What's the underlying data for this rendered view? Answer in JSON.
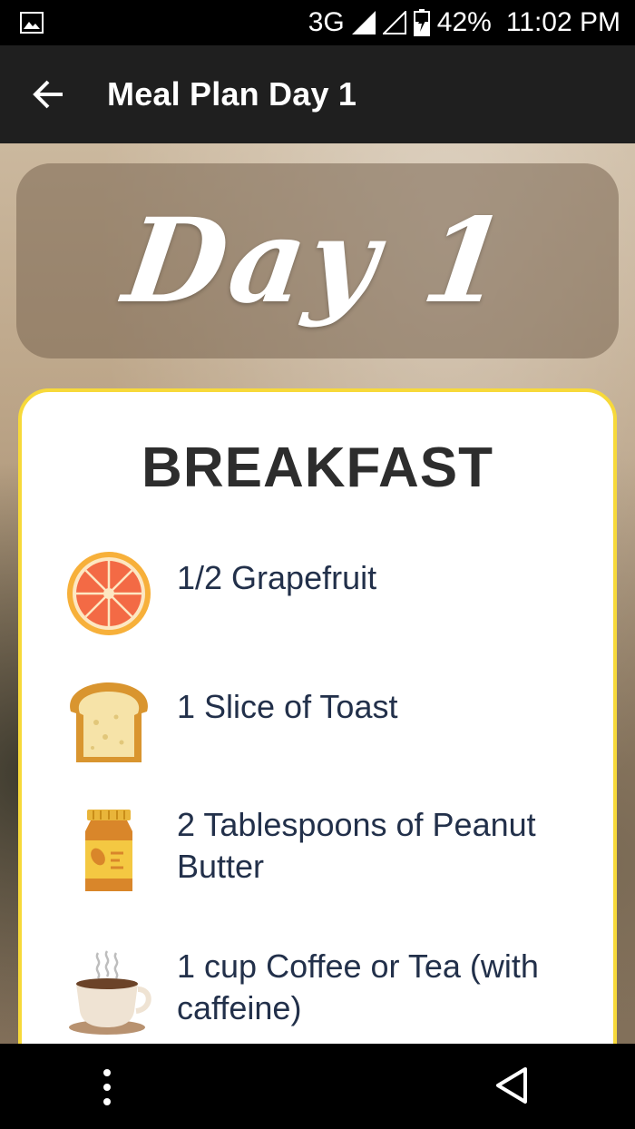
{
  "status_bar": {
    "network": "3G",
    "battery": "42%",
    "time": "11:02 PM"
  },
  "app_bar": {
    "title": "Meal Plan Day 1"
  },
  "banner": {
    "text": "Day 1"
  },
  "meal": {
    "title": "BREAKFAST",
    "items": [
      {
        "label": "1/2 Grapefruit",
        "icon": "grapefruit-icon"
      },
      {
        "label": "1 Slice of Toast",
        "icon": "toast-icon"
      },
      {
        "label": "2 Tablespoons of Peanut Butter",
        "icon": "peanut-butter-jar-icon"
      },
      {
        "label": "1 cup Coffee or Tea (with caffeine)",
        "icon": "coffee-cup-icon"
      }
    ]
  },
  "colors": {
    "app_bar": "#1f1f1f",
    "card_border": "#f7d93a",
    "item_text": "#22304a"
  }
}
